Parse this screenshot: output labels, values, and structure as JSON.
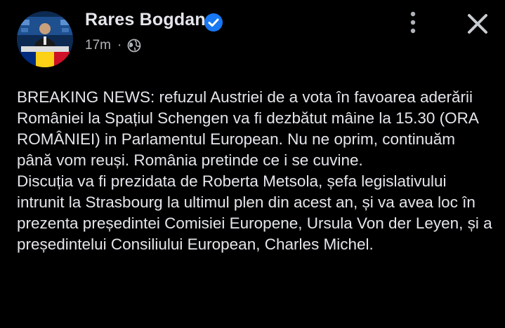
{
  "post": {
    "author": "Rares Bogdan",
    "verified_icon": "verified-badge-icon",
    "timestamp": "17m",
    "separator": "·",
    "privacy_icon": "globe-icon",
    "paragraphs": [
      "BREAKING NEWS: refuzul Austriei de a vota în favoarea aderării României la Spațiul Schengen va fi dezbătut mâine la 15.30 (ORA ROMÂNIEI) in Parlamentul European. Nu ne oprim, continuăm până vom reuși. România pretinde ce i se cuvine.",
      "Discuția va fi prezidata de Roberta Metsola, șefa legislativului intrunit la Strasbourg la ultimul plen din acest an, și va avea loc în prezenta președintei Comisiei Europene, Ursula Von der Leyen, și a președintelui Consiliului European, Charles Michel."
    ]
  },
  "toolbar": {
    "more_icon": "more-options-icon",
    "close_icon": "close-icon"
  },
  "colors": {
    "background": "#000000",
    "text_primary": "#e4e6eb",
    "text_secondary": "#b0b3b8",
    "verified_blue": "#1877f2"
  }
}
